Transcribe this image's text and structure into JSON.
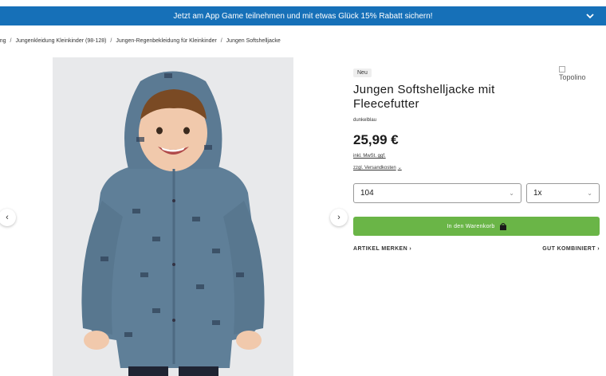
{
  "promo": {
    "text": "Jetzt am App Game teilnehmen und mit etwas Glück 15% Rabatt sichern!",
    "background": "#1670b8",
    "chevron_icon": "chevron-down-icon"
  },
  "breadcrumb": [
    "dung",
    "Jungenkleidung Kleinkinder (98-128)",
    "Jungen-Regenbekleidung für Kleinkinder",
    "Jungen Softshelljacke"
  ],
  "breadcrumb_separator": "/",
  "gallery": {
    "prev_icon": "chevron-left-icon",
    "next_icon": "chevron-right-icon",
    "prev_symbol": "‹",
    "next_symbol": "›"
  },
  "product": {
    "badge": "Neu",
    "brand_alt": "Topolino",
    "title": "Jungen Softshelljacke mit Fleecefutter",
    "color": "dunkelblau",
    "price": "25,99 €",
    "tax_note": "inkl. MwSt. ggf.",
    "shipping_note": "zzgl. Versandkosten",
    "shipping_chevron": "⌄"
  },
  "selectors": {
    "size_value": "104",
    "quantity_value": "1x",
    "chevron": "⌄"
  },
  "cart": {
    "label": "In den Warenkorb",
    "icon": "shopping-bag-icon",
    "color": "#6ab547"
  },
  "links": {
    "wishlist": "ARTIKEL MERKEN ›",
    "combine": "GUT KOMBINIERT ›"
  }
}
